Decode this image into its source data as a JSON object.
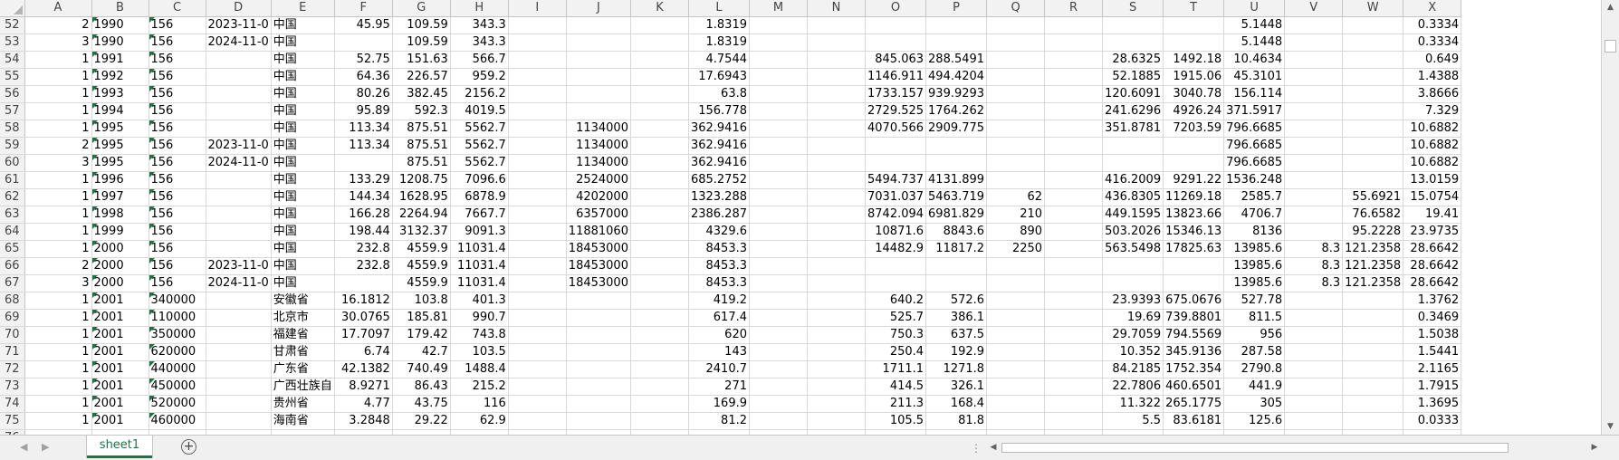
{
  "columns": [
    "A",
    "B",
    "C",
    "D",
    "E",
    "F",
    "G",
    "H",
    "I",
    "J",
    "K",
    "L",
    "M",
    "N",
    "O",
    "P",
    "Q",
    "R",
    "S",
    "T",
    "U",
    "V",
    "W",
    "X"
  ],
  "rows": [
    {
      "n": "52",
      "c": [
        "2",
        "1990",
        "156",
        "2023-11-0",
        "中国",
        "45.95",
        "109.59",
        "343.3",
        "",
        "",
        "",
        "1.8319",
        "",
        "",
        "",
        "",
        "",
        "",
        "",
        "",
        "5.1448",
        "",
        "",
        "0.3334"
      ]
    },
    {
      "n": "53",
      "c": [
        "3",
        "1990",
        "156",
        "2024-11-0",
        "中国",
        "",
        "109.59",
        "343.3",
        "",
        "",
        "",
        "1.8319",
        "",
        "",
        "",
        "",
        "",
        "",
        "",
        "",
        "5.1448",
        "",
        "",
        "0.3334"
      ]
    },
    {
      "n": "54",
      "c": [
        "1",
        "1991",
        "156",
        "",
        "中国",
        "52.75",
        "151.63",
        "566.7",
        "",
        "",
        "",
        "4.7544",
        "",
        "",
        "845.063",
        "288.5491",
        "",
        "",
        "28.6325",
        "1492.18",
        "10.4634",
        "",
        "",
        "0.649"
      ]
    },
    {
      "n": "55",
      "c": [
        "1",
        "1992",
        "156",
        "",
        "中国",
        "64.36",
        "226.57",
        "959.2",
        "",
        "",
        "",
        "17.6943",
        "",
        "",
        "1146.911",
        "494.4204",
        "",
        "",
        "52.1885",
        "1915.06",
        "45.3101",
        "",
        "",
        "1.4388"
      ]
    },
    {
      "n": "56",
      "c": [
        "1",
        "1993",
        "156",
        "",
        "中国",
        "80.26",
        "382.45",
        "2156.2",
        "",
        "",
        "",
        "63.8",
        "",
        "",
        "1733.157",
        "939.9293",
        "",
        "",
        "120.6091",
        "3040.78",
        "156.114",
        "",
        "",
        "3.8666"
      ]
    },
    {
      "n": "57",
      "c": [
        "1",
        "1994",
        "156",
        "",
        "中国",
        "95.89",
        "592.3",
        "4019.5",
        "",
        "",
        "",
        "156.778",
        "",
        "",
        "2729.525",
        "1764.262",
        "",
        "",
        "241.6296",
        "4926.24",
        "371.5917",
        "",
        "",
        "7.329"
      ]
    },
    {
      "n": "58",
      "c": [
        "1",
        "1995",
        "156",
        "",
        "中国",
        "113.34",
        "875.51",
        "5562.7",
        "",
        "1134000",
        "",
        "362.9416",
        "",
        "",
        "4070.566",
        "2909.775",
        "",
        "",
        "351.8781",
        "7203.59",
        "796.6685",
        "",
        "",
        "10.6882"
      ]
    },
    {
      "n": "59",
      "c": [
        "2",
        "1995",
        "156",
        "2023-11-0",
        "中国",
        "113.34",
        "875.51",
        "5562.7",
        "",
        "1134000",
        "",
        "362.9416",
        "",
        "",
        "",
        "",
        "",
        "",
        "",
        "",
        "796.6685",
        "",
        "",
        "10.6882"
      ]
    },
    {
      "n": "60",
      "c": [
        "3",
        "1995",
        "156",
        "2024-11-0",
        "中国",
        "",
        "875.51",
        "5562.7",
        "",
        "1134000",
        "",
        "362.9416",
        "",
        "",
        "",
        "",
        "",
        "",
        "",
        "",
        "796.6685",
        "",
        "",
        "10.6882"
      ]
    },
    {
      "n": "61",
      "c": [
        "1",
        "1996",
        "156",
        "",
        "中国",
        "133.29",
        "1208.75",
        "7096.6",
        "",
        "2524000",
        "",
        "685.2752",
        "",
        "",
        "5494.737",
        "4131.899",
        "",
        "",
        "416.2009",
        "9291.22",
        "1536.248",
        "",
        "",
        "13.0159"
      ]
    },
    {
      "n": "62",
      "c": [
        "1",
        "1997",
        "156",
        "",
        "中国",
        "144.34",
        "1628.95",
        "6878.9",
        "",
        "4202000",
        "",
        "1323.288",
        "",
        "",
        "7031.037",
        "5463.719",
        "62",
        "",
        "436.8305",
        "11269.18",
        "2585.7",
        "",
        "55.6921",
        "15.0754"
      ]
    },
    {
      "n": "63",
      "c": [
        "1",
        "1998",
        "156",
        "",
        "中国",
        "166.28",
        "2264.94",
        "7667.7",
        "",
        "6357000",
        "",
        "2386.287",
        "",
        "",
        "8742.094",
        "6981.829",
        "210",
        "",
        "449.1595",
        "13823.66",
        "4706.7",
        "",
        "76.6582",
        "19.41"
      ]
    },
    {
      "n": "64",
      "c": [
        "1",
        "1999",
        "156",
        "",
        "中国",
        "198.44",
        "3132.37",
        "9091.3",
        "",
        "11881060",
        "",
        "4329.6",
        "",
        "",
        "10871.6",
        "8843.6",
        "890",
        "",
        "503.2026",
        "15346.13",
        "8136",
        "",
        "95.2228",
        "23.9735"
      ]
    },
    {
      "n": "65",
      "c": [
        "1",
        "2000",
        "156",
        "",
        "中国",
        "232.8",
        "4559.9",
        "11031.4",
        "",
        "18453000",
        "",
        "8453.3",
        "",
        "",
        "14482.9",
        "11817.2",
        "2250",
        "",
        "563.5498",
        "17825.63",
        "13985.6",
        "8.3",
        "121.2358",
        "28.6642"
      ]
    },
    {
      "n": "66",
      "c": [
        "2",
        "2000",
        "156",
        "2023-11-0",
        "中国",
        "232.8",
        "4559.9",
        "11031.4",
        "",
        "18453000",
        "",
        "8453.3",
        "",
        "",
        "",
        "",
        "",
        "",
        "",
        "",
        "13985.6",
        "8.3",
        "121.2358",
        "28.6642"
      ]
    },
    {
      "n": "67",
      "c": [
        "3",
        "2000",
        "156",
        "2024-11-0",
        "中国",
        "",
        "4559.9",
        "11031.4",
        "",
        "18453000",
        "",
        "8453.3",
        "",
        "",
        "",
        "",
        "",
        "",
        "",
        "",
        "13985.6",
        "8.3",
        "121.2358",
        "28.6642"
      ]
    },
    {
      "n": "68",
      "c": [
        "1",
        "2001",
        "340000",
        "",
        "安徽省",
        "16.1812",
        "103.8",
        "401.3",
        "",
        "",
        "",
        "419.2",
        "",
        "",
        "640.2",
        "572.6",
        "",
        "",
        "23.9393",
        "675.0676",
        "527.78",
        "",
        "",
        "1.3762"
      ]
    },
    {
      "n": "69",
      "c": [
        "1",
        "2001",
        "110000",
        "",
        "北京市",
        "30.0765",
        "185.81",
        "990.7",
        "",
        "",
        "",
        "617.4",
        "",
        "",
        "525.7",
        "386.1",
        "",
        "",
        "19.69",
        "739.8801",
        "811.5",
        "",
        "",
        "0.3469"
      ]
    },
    {
      "n": "70",
      "c": [
        "1",
        "2001",
        "350000",
        "",
        "福建省",
        "17.7097",
        "179.42",
        "743.8",
        "",
        "",
        "",
        "620",
        "",
        "",
        "750.3",
        "637.5",
        "",
        "",
        "29.7059",
        "794.5569",
        "956",
        "",
        "",
        "1.5038"
      ]
    },
    {
      "n": "71",
      "c": [
        "1",
        "2001",
        "620000",
        "",
        "甘肃省",
        "6.74",
        "42.7",
        "103.5",
        "",
        "",
        "",
        "143",
        "",
        "",
        "250.4",
        "192.9",
        "",
        "",
        "10.352",
        "345.9136",
        "287.58",
        "",
        "",
        "1.5441"
      ]
    },
    {
      "n": "72",
      "c": [
        "1",
        "2001",
        "440000",
        "",
        "广东省",
        "42.1382",
        "740.49",
        "1488.4",
        "",
        "",
        "",
        "2410.7",
        "",
        "",
        "1711.1",
        "1271.8",
        "",
        "",
        "84.2185",
        "1752.354",
        "2790.8",
        "",
        "",
        "2.1165"
      ]
    },
    {
      "n": "73",
      "c": [
        "1",
        "2001",
        "450000",
        "",
        "广西壮族自",
        "8.9271",
        "86.43",
        "215.2",
        "",
        "",
        "",
        "271",
        "",
        "",
        "414.5",
        "326.1",
        "",
        "",
        "22.7806",
        "460.6501",
        "441.9",
        "",
        "",
        "1.7915"
      ]
    },
    {
      "n": "74",
      "c": [
        "1",
        "2001",
        "520000",
        "",
        "贵州省",
        "4.77",
        "43.75",
        "116",
        "",
        "",
        "",
        "169.9",
        "",
        "",
        "211.3",
        "168.4",
        "",
        "",
        "11.322",
        "265.1775",
        "305",
        "",
        "",
        "1.3695"
      ]
    },
    {
      "n": "75",
      "c": [
        "1",
        "2001",
        "460000",
        "",
        "海南省",
        "3.2848",
        "29.22",
        "62.9",
        "",
        "",
        "",
        "81.2",
        "",
        "",
        "105.5",
        "81.8",
        "",
        "",
        "5.5",
        "83.6181",
        "125.6",
        "",
        "",
        "0.0333"
      ]
    },
    {
      "n": "76",
      "c": [
        "",
        "",
        "",
        "",
        "",
        "",
        "",
        "",
        "",
        "",
        "",
        "",
        "",
        "",
        "",
        "",
        "",
        "",
        "",
        "",
        "",
        "",
        "",
        ""
      ]
    }
  ],
  "sheet_tabs": [
    "sheet1"
  ],
  "icons": {
    "add_sheet": "plus-circle-icon",
    "scroll_up": "triangle-up-icon",
    "scroll_down": "triangle-down-icon",
    "scroll_left": "triangle-left-icon",
    "scroll_right": "triangle-right-icon"
  },
  "colors": {
    "accent": "#217346",
    "flag": "#1e7145",
    "header_bg": "#f2f2f2",
    "grid": "#d9d9d9"
  }
}
